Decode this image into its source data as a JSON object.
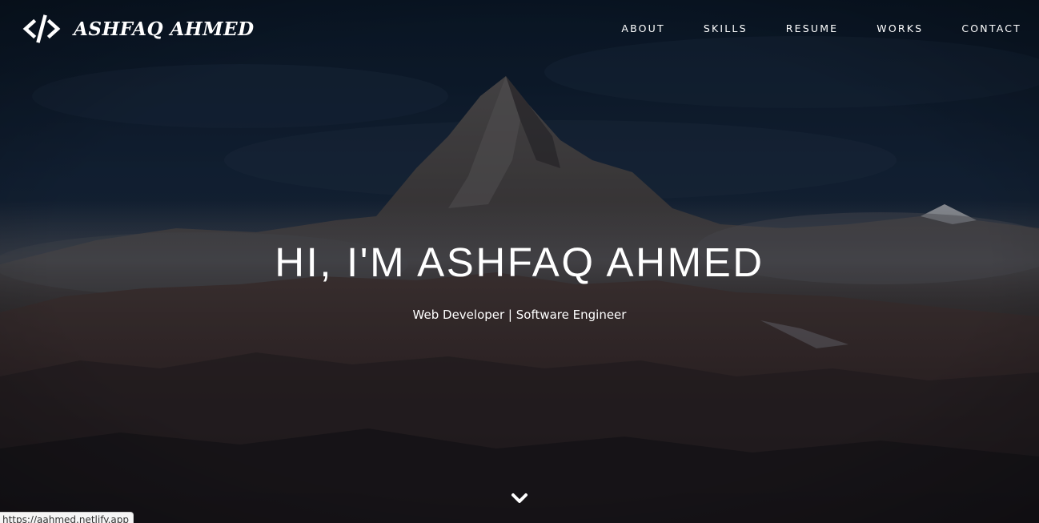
{
  "brand": {
    "name": "ASHFAQ AHMED",
    "icon": "code-slash-icon"
  },
  "nav": {
    "items": [
      {
        "label": "ABOUT"
      },
      {
        "label": "SKILLS"
      },
      {
        "label": "RESUME"
      },
      {
        "label": "WORKS"
      },
      {
        "label": "CONTACT"
      }
    ]
  },
  "hero": {
    "title": "HI, I'M ASHFAQ AHMED",
    "subtitle": "Web Developer | Software Engineer",
    "scroll_icon": "chevron-down-icon"
  },
  "status_bar": {
    "url": "https://aahmed.netlify.app"
  },
  "colors": {
    "text": "#ffffff",
    "sky": "#0c1a2a",
    "mountain": "#2a2526"
  }
}
